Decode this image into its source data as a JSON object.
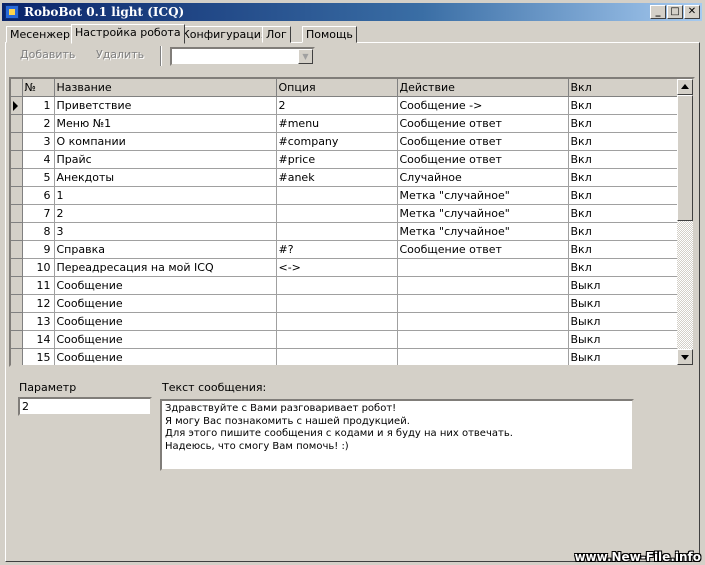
{
  "window": {
    "title": "RoboBot 0.1 light (ICQ)",
    "title_buttons": {
      "minimize": "_",
      "maximize": "□",
      "close": "✕"
    }
  },
  "tabs": [
    {
      "label": "Месенжер",
      "active": false
    },
    {
      "label": "Настройка робота",
      "active": true
    },
    {
      "label": "Конфигурация",
      "active": false
    },
    {
      "label": "Лог",
      "active": false
    },
    {
      "label": "Помощь",
      "active": false
    }
  ],
  "toolbar": {
    "add_label": "Добавить",
    "delete_label": "Удалить",
    "combo_value": ""
  },
  "grid": {
    "columns": [
      "№",
      "Название",
      "Опция",
      "Действие",
      "Вкл"
    ],
    "selected_row": 1,
    "rows": [
      {
        "n": "1",
        "name": "Приветствие",
        "option": "2",
        "action": "Сообщение ->",
        "on": "Вкл"
      },
      {
        "n": "2",
        "name": "Меню №1",
        "option": "#menu",
        "action": "Сообщение ответ",
        "on": "Вкл"
      },
      {
        "n": "3",
        "name": "О компании",
        "option": "#company",
        "action": "Сообщение ответ",
        "on": "Вкл"
      },
      {
        "n": "4",
        "name": "Прайс",
        "option": "#price",
        "action": "Сообщение ответ",
        "on": "Вкл"
      },
      {
        "n": "5",
        "name": "Анекдоты",
        "option": "#anek",
        "action": "Случайное",
        "on": "Вкл"
      },
      {
        "n": "6",
        "name": "1",
        "option": "",
        "action": "Метка \"случайное\"",
        "on": "Вкл"
      },
      {
        "n": "7",
        "name": "2",
        "option": "",
        "action": "Метка \"случайное\"",
        "on": "Вкл"
      },
      {
        "n": "8",
        "name": "3",
        "option": "",
        "action": "Метка \"случайное\"",
        "on": "Вкл"
      },
      {
        "n": "9",
        "name": "Справка",
        "option": "#?",
        "action": "Сообщение ответ",
        "on": "Вкл"
      },
      {
        "n": "10",
        "name": "Переадресация на мой ICQ",
        "option": "<->",
        "action": "",
        "on": "Вкл"
      },
      {
        "n": "11",
        "name": "Сообщение",
        "option": "",
        "action": "",
        "on": "Выкл"
      },
      {
        "n": "12",
        "name": "Сообщение",
        "option": "",
        "action": "",
        "on": "Выкл"
      },
      {
        "n": "13",
        "name": "Сообщение",
        "option": "",
        "action": "",
        "on": "Выкл"
      },
      {
        "n": "14",
        "name": "Сообщение",
        "option": "",
        "action": "",
        "on": "Выкл"
      },
      {
        "n": "15",
        "name": "Сообщение",
        "option": "",
        "action": "",
        "on": "Выкл"
      }
    ]
  },
  "parameter": {
    "label": "Параметр",
    "value": "2"
  },
  "message": {
    "label": "Текст сообщения:",
    "lines": [
      "Здравствуйте с Вами разговаривает робот!",
      "Я могу Вас познакомить с нашей продукцией.",
      "Для этого пишите сообщения с кодами и я буду на них отвечать.",
      "Надеюсь, что смогу Вам помочь! :)"
    ]
  },
  "watermark": "www.New-File.info"
}
